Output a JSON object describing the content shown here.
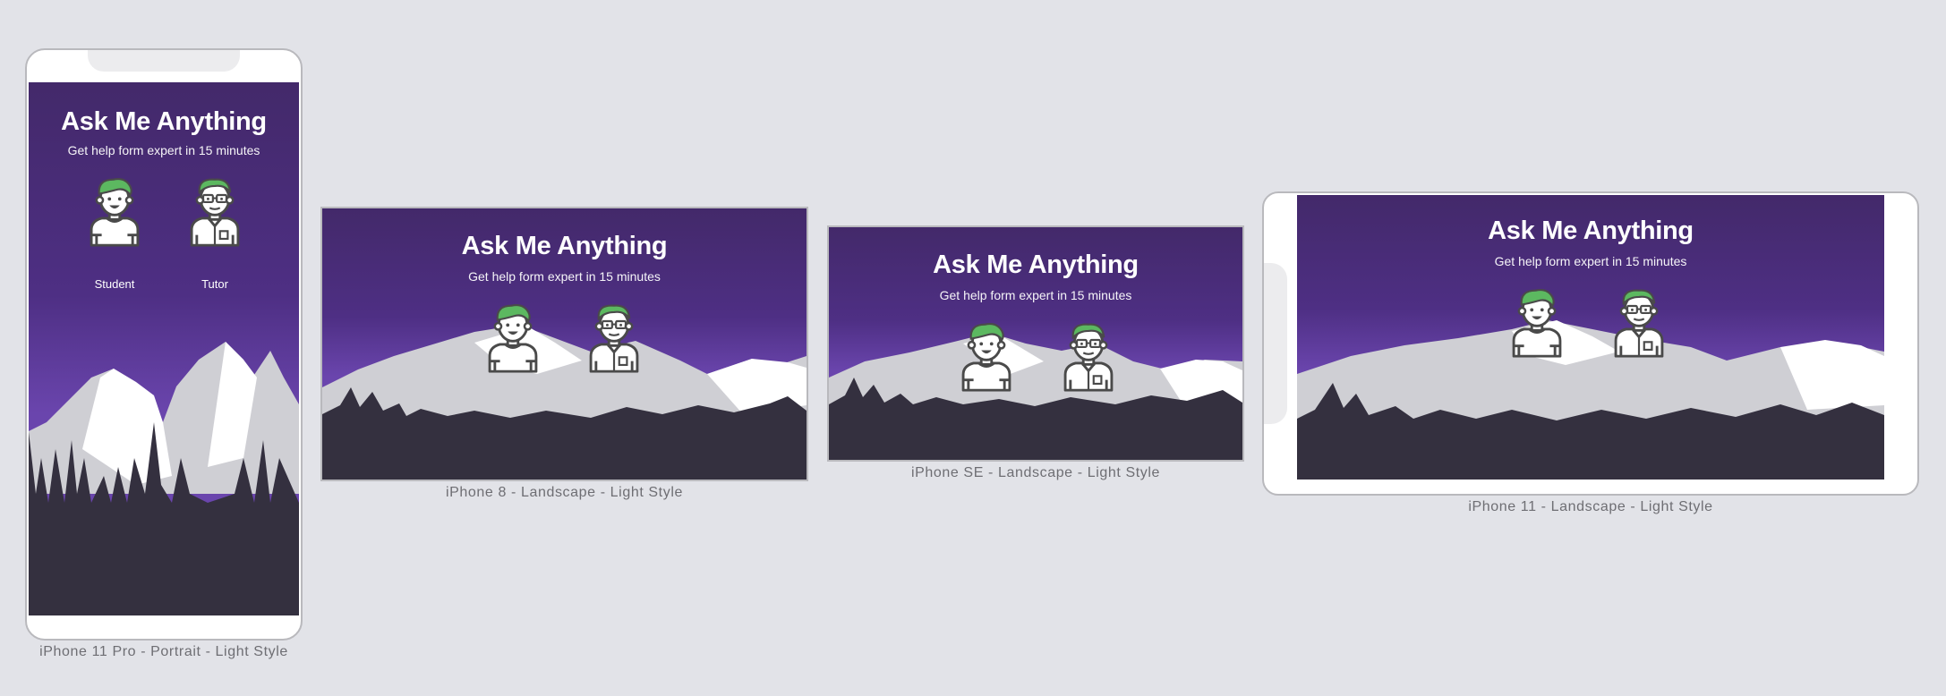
{
  "app": {
    "title": "Ask Me Anything",
    "subtitle": "Get help form expert in 15 minutes"
  },
  "roles": {
    "student": "Student",
    "tutor": "Tutor"
  },
  "devices": [
    {
      "caption": "iPhone 11 Pro - Portrait - Light Style"
    },
    {
      "caption": "iPhone 8 - Landscape - Light Style"
    },
    {
      "caption": "iPhone SE - Landscape - Light Style"
    },
    {
      "caption": "iPhone 11 - Landscape - Light Style"
    }
  ],
  "colors": {
    "canvas": "#e2e3e8",
    "sky_top": "#43296a",
    "sky_bottom": "#6a45ad",
    "ground": "#34303f",
    "hair": "#5cb860",
    "outline": "#4a4a4a"
  },
  "icons": {
    "student": "student-avatar-icon",
    "tutor": "tutor-avatar-icon"
  }
}
